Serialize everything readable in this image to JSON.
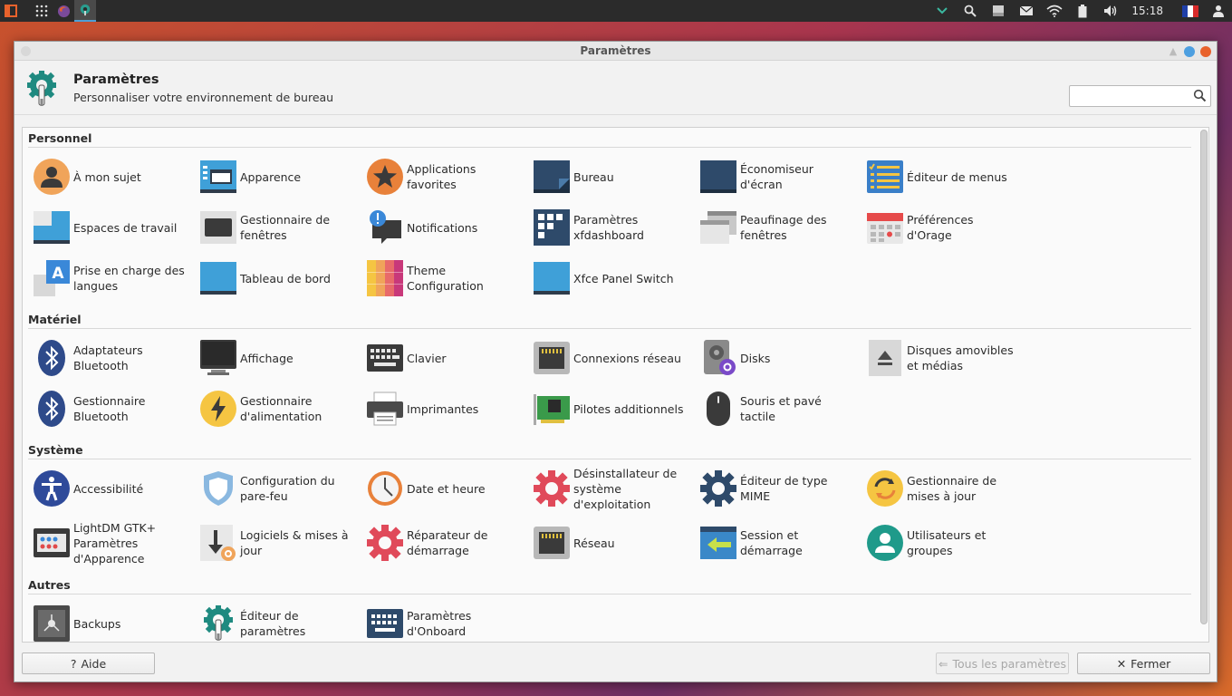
{
  "panel": {
    "clock": "15:18",
    "flag": "🇫🇷"
  },
  "window": {
    "title": "Paramètres"
  },
  "header": {
    "title": "Paramètres",
    "subtitle": "Personnaliser votre environnement de bureau",
    "search_placeholder": ""
  },
  "sections": {
    "personnel": "Personnel",
    "materiel": "Matériel",
    "systeme": "Système",
    "autres": "Autres"
  },
  "items": {
    "a_mon_sujet": "À mon sujet",
    "apparence": "Apparence",
    "applications_favorites": "Applications favorites",
    "bureau": "Bureau",
    "economiseur": "Économiseur d'écran",
    "editeur_menus": "Éditeur de menus",
    "espaces_travail": "Espaces de travail",
    "gestionnaire_fenetres": "Gestionnaire de fenêtres",
    "notifications": "Notifications",
    "parametres_xfdashboard": "Paramètres xfdashboard",
    "peaufinage": "Peaufinage des fenêtres",
    "orage": "Préférences d'Orage",
    "langues": "Prise en charge des langues",
    "tableau_bord": "Tableau de bord",
    "theme_config": "Theme Configuration",
    "panel_switch": "Xfce Panel Switch",
    "bluetooth_adapt": "Adaptateurs Bluetooth",
    "affichage": "Affichage",
    "clavier": "Clavier",
    "connexions": "Connexions réseau",
    "disks": "Disks",
    "disques_amovibles": "Disques amovibles et médias",
    "gest_bluetooth": "Gestionnaire Bluetooth",
    "gest_alimentation": "Gestionnaire d'alimentation",
    "imprimantes": "Imprimantes",
    "pilotes": "Pilotes additionnels",
    "souris": "Souris et pavé tactile",
    "accessibilite": "Accessibilité",
    "pare_feu": "Configuration du pare-feu",
    "date_heure": "Date et heure",
    "desinstallateur": "Désinstallateur de système d'exploitation",
    "mime": "Éditeur de type MIME",
    "gest_maj": "Gestionnaire de mises à jour",
    "lightdm": "LightDM GTK+ Paramètres d'Apparence",
    "logiciels_maj": "Logiciels & mises à jour",
    "reparateur": "Réparateur de démarrage",
    "reseau": "Réseau",
    "session": "Session et démarrage",
    "utilisateurs": "Utilisateurs et groupes",
    "backups": "Backups",
    "editeur_parametres": "Éditeur de paramètres",
    "onboard": "Paramètres d'Onboard"
  },
  "footer": {
    "help": "Aide",
    "all_settings": "Tous les paramètres",
    "close": "Fermer"
  }
}
